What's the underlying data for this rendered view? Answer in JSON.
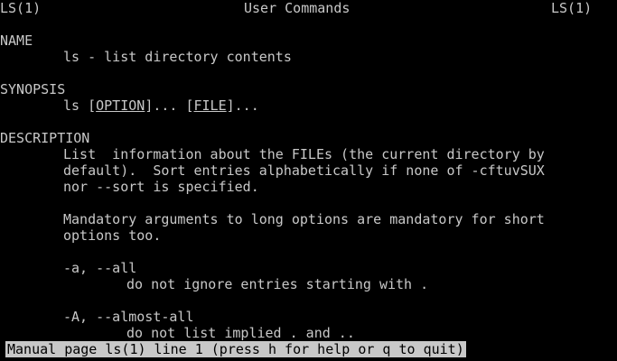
{
  "header": {
    "left": "LS(1)",
    "center": "User Commands",
    "right": "LS(1)"
  },
  "sections": {
    "name": {
      "heading": "NAME",
      "text": "ls - list directory contents"
    },
    "synopsis": {
      "heading": "SYNOPSIS",
      "command": "ls",
      "option": "OPTION",
      "option_suffix": "]...",
      "file": "FILE",
      "file_suffix": "]..."
    },
    "description": {
      "heading": "DESCRIPTION",
      "para1_line1": "List  information about the FILEs (the current directory by",
      "para1_line2": "default).  Sort entries alphabetically if none of -cftuvSUX",
      "para1_line3": "nor --sort is specified.",
      "para2_line1": "Mandatory arguments to long options are mandatory for short",
      "para2_line2": "options too.",
      "opt_a_flag": "-a, --all",
      "opt_a_desc": "do not ignore entries starting with .",
      "opt_A_flag": "-A, --almost-all",
      "opt_A_desc": "do not list implied . and .."
    }
  },
  "status_bar": {
    "text": "Manual page ls(1) line 1 (press h for help or q to quit)"
  },
  "colors": {
    "background": "#000000",
    "foreground": "#c8c8c8"
  }
}
